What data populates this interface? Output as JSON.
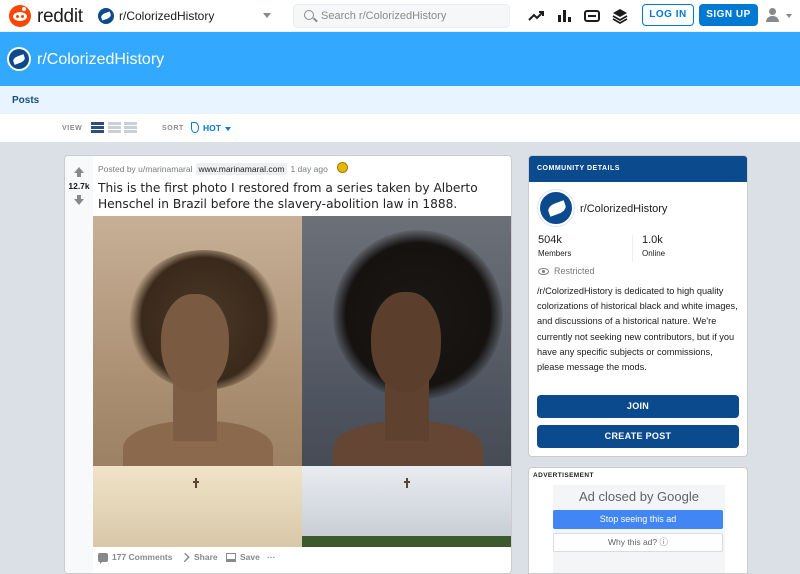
{
  "header": {
    "brand": "reddit",
    "community_selector": "r/ColorizedHistory",
    "search_placeholder": "Search r/ColorizedHistory",
    "login_label": "LOG IN",
    "signup_label": "SIGN UP",
    "icons": [
      "popular-icon",
      "all-icon",
      "coins-icon",
      "feed-icon"
    ]
  },
  "banner": {
    "title": "r/ColorizedHistory"
  },
  "subnav": {
    "tab": "Posts"
  },
  "viewbar": {
    "view_label": "VIEW",
    "sort_label": "SORT",
    "sort_value": "HOT"
  },
  "post": {
    "score": "12.7k",
    "posted_by": "Posted by u/marinamaral",
    "domain": "www.marinamaral.com",
    "time": "1 day ago",
    "title": "This is the first photo I restored from a series taken by Alberto Henschel in Brazil before the slavery-abolition law in 1888.",
    "actions": {
      "comments": "177 Comments",
      "share": "Share",
      "save": "Save",
      "more": "···"
    }
  },
  "community": {
    "header": "COMMUNITY DETAILS",
    "name": "r/ColorizedHistory",
    "members": {
      "value": "504k",
      "label": "Members"
    },
    "online": {
      "value": "1.0k",
      "label": "Online"
    },
    "restricted": "Restricted",
    "description": "/r/ColorizedHistory is dedicated to high quality colorizations of historical black and white images, and discussions of a historical nature. We're currently not seeking new contributors, but if you have any specific subjects or commissions, please message the mods.",
    "join_label": "JOIN",
    "create_label": "CREATE POST"
  },
  "ad": {
    "label": "ADVERTISEMENT",
    "closed_text": "Ad closed by Google",
    "stop_label": "Stop seeing this ad",
    "why_label": "Why this ad? ⓘ"
  },
  "colors": {
    "accent": "#0079d3",
    "brand": "#ff4500",
    "community": "#0c4a8e",
    "banner": "#33a8ff"
  }
}
